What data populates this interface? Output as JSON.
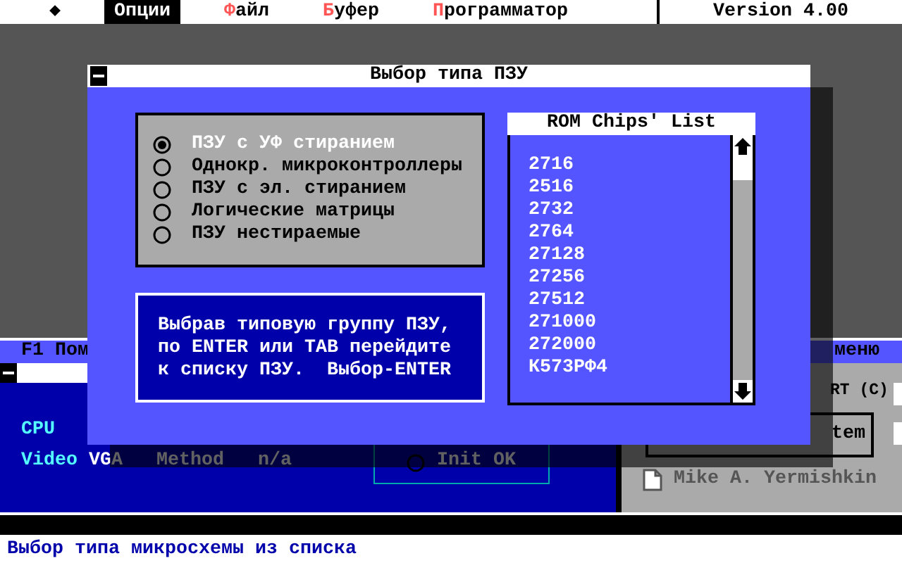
{
  "menu_bar": {
    "items": [
      {
        "label": "◆",
        "selected": false,
        "hotkey": false
      },
      {
        "label": "Опции",
        "selected": true,
        "hotkey": false
      },
      {
        "label": "Файл",
        "selected": false,
        "hotkey": true
      },
      {
        "label": "Буфер",
        "selected": false,
        "hotkey": true
      },
      {
        "label": "Программатор",
        "selected": false,
        "hotkey": true
      }
    ],
    "version": "Version 4.00"
  },
  "background_window": {
    "title_left": "F1 Пом",
    "title_right": "меню",
    "info": {
      "cpu_label": "CPU",
      "video_label": "Video",
      "video_value": "VGA",
      "method_label": "Method",
      "method_value": "n/a",
      "init_status": "Init OK",
      "init_checked": false
    },
    "about": {
      "copyright": "RT (C)",
      "button": "tem",
      "author": "Mike A. Yermishkin"
    }
  },
  "dialog": {
    "title": "Выбор типа ПЗУ",
    "rom_types": [
      {
        "label": "ПЗУ с УФ стиранием",
        "selected": true
      },
      {
        "label": "Однокр. микроконтроллеры",
        "selected": false
      },
      {
        "label": "ПЗУ с эл. стиранием",
        "selected": false
      },
      {
        "label": "Логические матрицы",
        "selected": false
      },
      {
        "label": "ПЗУ нестираемые",
        "selected": false
      }
    ],
    "hint": [
      "Выбрав типовую группу ПЗУ,",
      "по ENTER или TAB перейдите",
      "к списку ПЗУ.  Выбор-ENTER"
    ],
    "chip_list": {
      "title": "ROM Chips' List",
      "items": [
        "2716",
        "2516",
        "2732",
        "2764",
        "27128",
        "27256",
        "27512",
        "271000",
        "272000",
        "К573РФ4"
      ]
    }
  },
  "status_bar": "Выбор типа микросхемы из списка"
}
